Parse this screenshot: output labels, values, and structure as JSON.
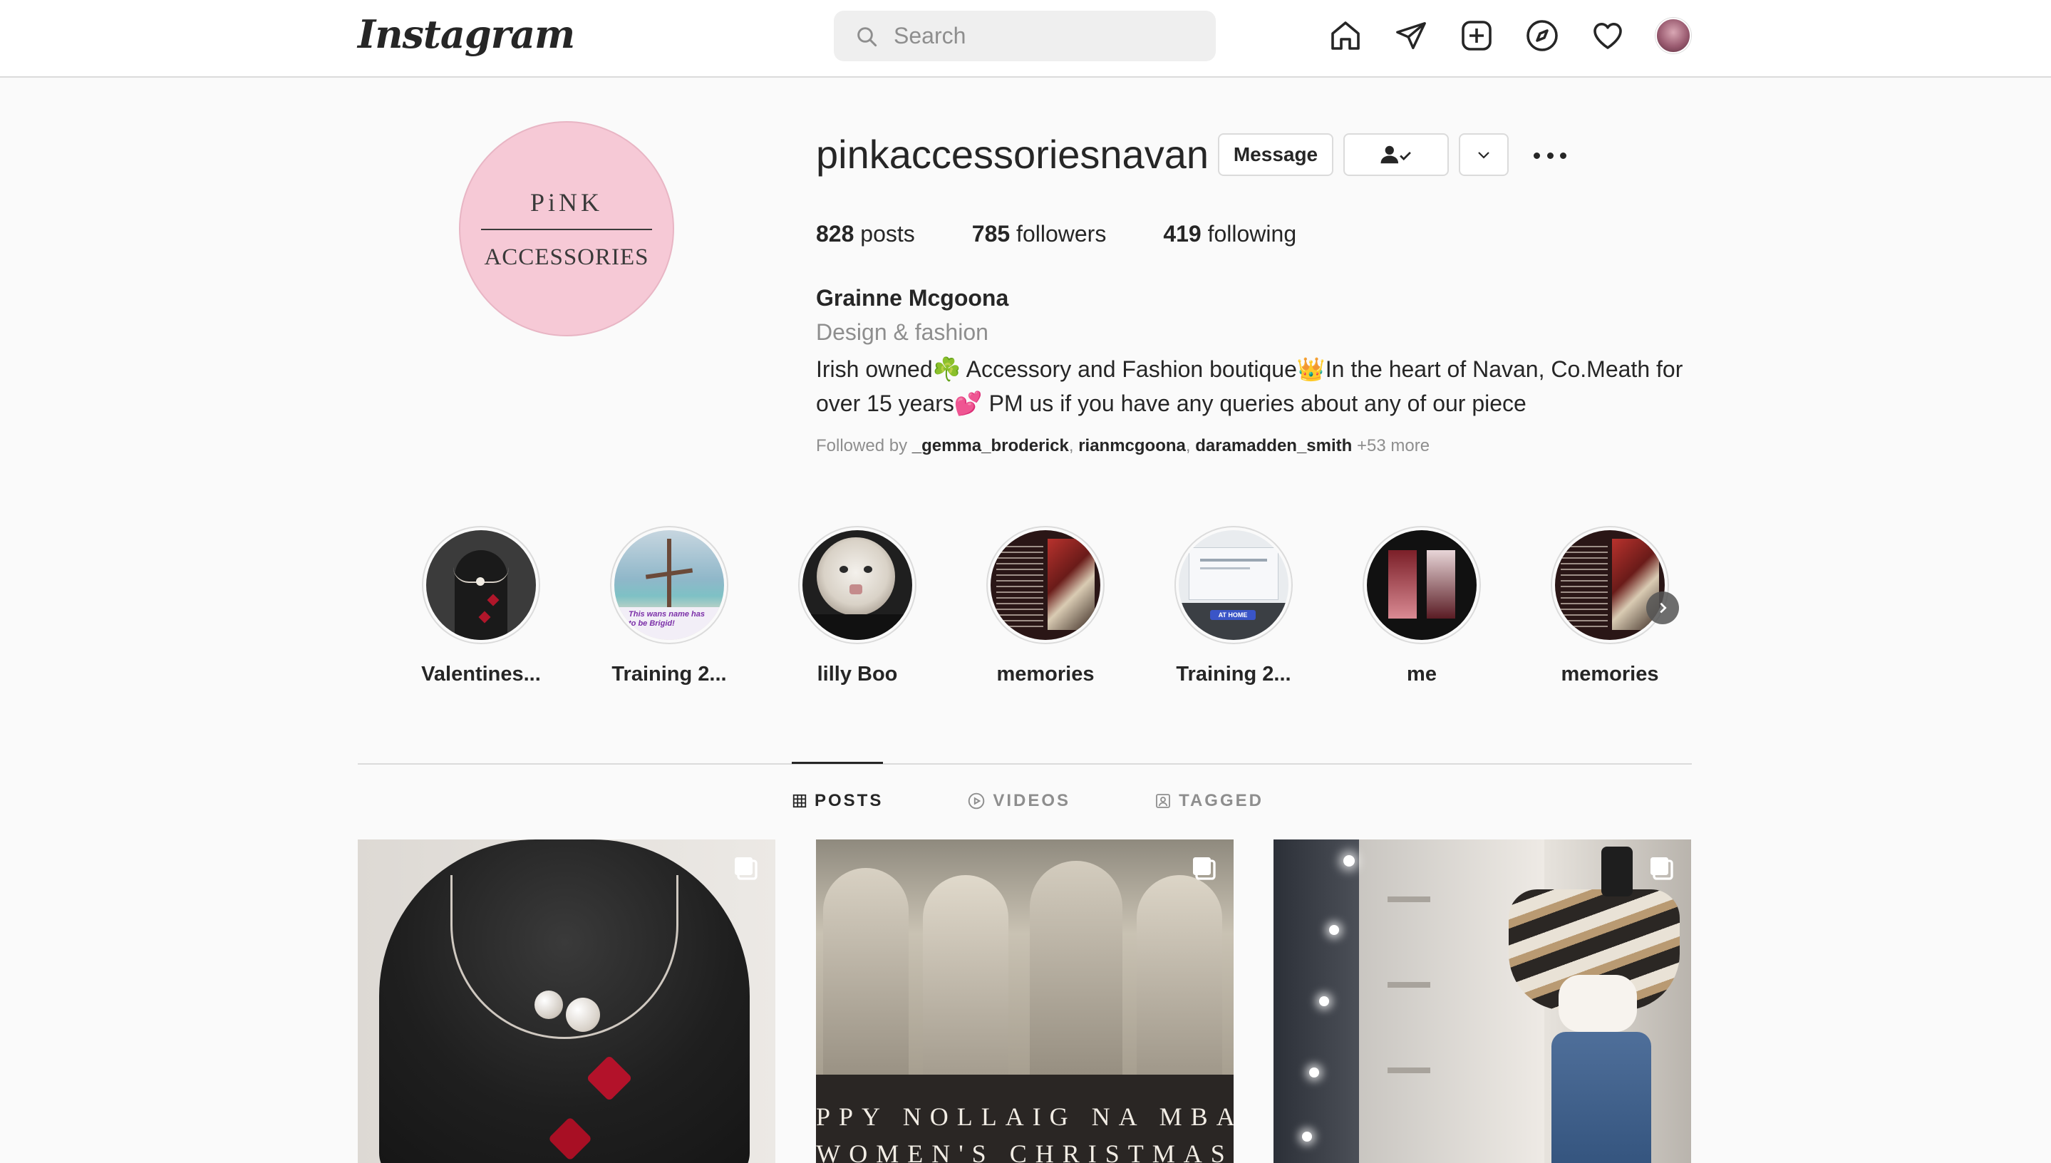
{
  "app": {
    "logo_text": "Instagram"
  },
  "search": {
    "placeholder": "Search"
  },
  "nav": {
    "icons": [
      "home-icon",
      "direct-icon",
      "new-post-icon",
      "explore-icon",
      "activity-heart-icon",
      "profile-avatar"
    ]
  },
  "profile": {
    "avatar_text_top": "PiNK",
    "avatar_text_bottom": "ACCESSORIES",
    "username": "pinkaccessoriesnavan",
    "message_button": "Message",
    "stats": {
      "posts_count": "828",
      "posts_label": "posts",
      "followers_count": "785",
      "followers_label": "followers",
      "following_count": "419",
      "following_label": "following"
    },
    "full_name": "Grainne Mcgoona",
    "category": "Design & fashion",
    "bio": "Irish owned☘️ Accessory and Fashion boutique👑In the heart of Navan, Co.Meath for over 15 years💕 PM us if you have any queries about any of our piece",
    "followed_by": {
      "prefix": "Followed by ",
      "users": [
        "_gemma_broderick",
        "rianmcgoona",
        "daramadden_smith"
      ],
      "more": "+53 more"
    }
  },
  "highlights": [
    {
      "label": "Valentines...",
      "thumb": "necklace-stand"
    },
    {
      "label": "Training 2...",
      "thumb": "beach-cross",
      "caption": "This wans name has to be Brigid!"
    },
    {
      "label": "lilly Boo",
      "thumb": "fluffy-cat"
    },
    {
      "label": "memories",
      "thumb": "text-and-shop"
    },
    {
      "label": "Training 2...",
      "thumb": "laptop-screen",
      "caption": "AT HOME"
    },
    {
      "label": "me",
      "thumb": "shop-floor"
    },
    {
      "label": "memories",
      "thumb": "text-and-shop"
    }
  ],
  "tabs": [
    {
      "label": "POSTS",
      "icon": "grid-icon",
      "active": true
    },
    {
      "label": "VIDEOS",
      "icon": "play-icon",
      "active": false
    },
    {
      "label": "TAGGED",
      "icon": "tag-icon",
      "active": false
    }
  ],
  "posts": [
    {
      "subject": "pearl choker on black bust with red hearts",
      "multi": true
    },
    {
      "subject": "vintage photo of women toasting",
      "banner_line1": "PPY NOLLAIG NA MBA",
      "banner_line2": "WOMEN'S CHRISTMAS",
      "multi": true
    },
    {
      "subject": "mirror selfie striped poncho",
      "multi": true
    }
  ],
  "colors": {
    "background": "#fafafa",
    "border": "#dbdbdb",
    "text": "#262626",
    "muted": "#8e8e8e",
    "profile_pink": "#f6c9d6"
  }
}
